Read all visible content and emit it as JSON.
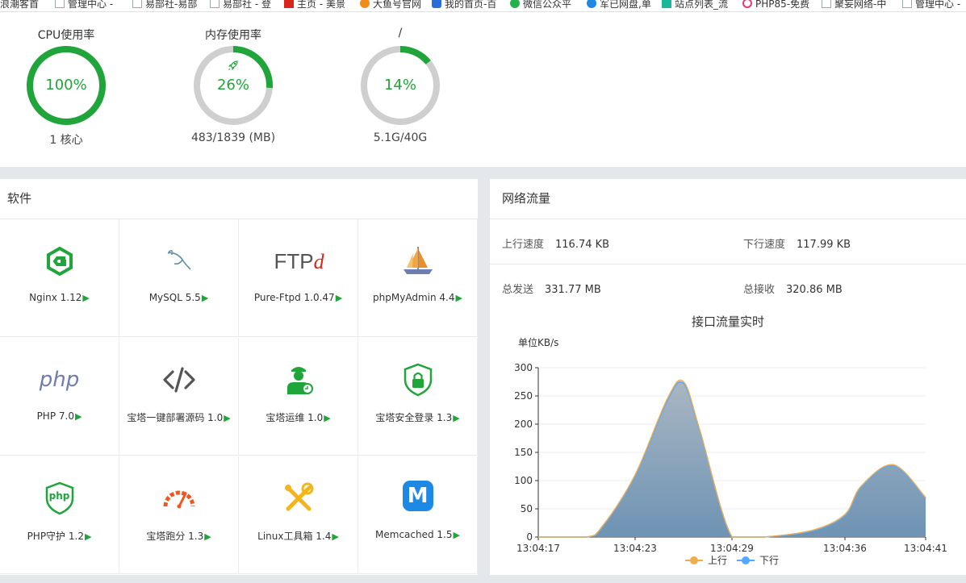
{
  "bookmarks": [
    {
      "label": "浪潮客首",
      "icon": "none"
    },
    {
      "label": "管理中心 -",
      "icon": "page"
    },
    {
      "label": "易部社-易部",
      "icon": "page"
    },
    {
      "label": "易部社 - 登",
      "icon": "page"
    },
    {
      "label": "主页 - 美景",
      "icon": "red"
    },
    {
      "label": "大鱼号官网",
      "icon": "orange"
    },
    {
      "label": "我的首页-百",
      "icon": "blue"
    },
    {
      "label": "微信公众平",
      "icon": "green"
    },
    {
      "label": "军已网盘,单",
      "icon": "lblue"
    },
    {
      "label": "站点列表_流",
      "icon": "teal"
    },
    {
      "label": "PHP85-免费",
      "icon": "ring"
    },
    {
      "label": "聚妄网络-中",
      "icon": "page"
    },
    {
      "label": "管理中心 -",
      "icon": "page"
    }
  ],
  "gauges": [
    {
      "label": "CPU使用率",
      "percent": 100,
      "value_text": "100%",
      "sub": "1 核心",
      "color": "#20a53a"
    },
    {
      "label": "内存使用率",
      "percent": 26,
      "value_text": "26%",
      "sub": "483/1839 (MB)",
      "color": "#20a53a",
      "icon": "rocket-icon"
    },
    {
      "label": "/",
      "percent": 14,
      "value_text": "14%",
      "sub": "5.1G/40G",
      "color": "#20a53a"
    }
  ],
  "software": {
    "title": "软件",
    "items": [
      {
        "name": "Nginx 1.12",
        "icon": "nginx-icon"
      },
      {
        "name": "MySQL 5.5",
        "icon": "mysql-icon"
      },
      {
        "name": "Pure-Ftpd 1.0.47",
        "icon": "ftp-icon",
        "icon_text": "FTP",
        "icon_text2": "d"
      },
      {
        "name": "phpMyAdmin 4.4",
        "icon": "phpmyadmin-icon"
      },
      {
        "name": "PHP 7.0",
        "icon": "php-icon",
        "icon_text": "php"
      },
      {
        "name": "宝塔一键部署源码 1.0",
        "icon": "code-icon"
      },
      {
        "name": "宝塔运维 1.0",
        "icon": "operator-icon"
      },
      {
        "name": "宝塔安全登录 1.3",
        "icon": "shield-lock-icon"
      },
      {
        "name": "PHP守护 1.2",
        "icon": "php-guard-icon",
        "icon_text": "php"
      },
      {
        "name": "宝塔跑分 1.3",
        "icon": "speedometer-icon"
      },
      {
        "name": "Linux工具箱 1.4",
        "icon": "tools-icon"
      },
      {
        "name": "Memcached 1.5",
        "icon": "memcached-icon",
        "icon_text": "M"
      }
    ],
    "arrow": "▶"
  },
  "network": {
    "title": "网络流量",
    "up_speed_label": "上行速度",
    "up_speed": "116.74 KB",
    "down_speed_label": "下行速度",
    "down_speed": "117.99 KB",
    "total_sent_label": "总发送",
    "total_sent": "331.77 MB",
    "total_recv_label": "总接收",
    "total_recv": "320.86 MB"
  },
  "chart_data": {
    "type": "area",
    "title": "接口流量实时",
    "ylabel": "单位KB/s",
    "ylim": [
      0,
      300
    ],
    "yticks": [
      0,
      50,
      100,
      150,
      200,
      250,
      300
    ],
    "x_range": [
      "13:04:17",
      "13:04:41"
    ],
    "x": [
      "13:04:17",
      "13:04:20",
      "13:04:21",
      "13:04:23",
      "13:04:25",
      "13:04:26",
      "13:04:27",
      "13:04:29",
      "13:04:31",
      "13:04:34",
      "13:04:36",
      "13:04:37",
      "13:04:39",
      "13:04:41"
    ],
    "xtick_labels": [
      "13:04:17",
      "13:04:23",
      "13:04:29",
      "13:04:36",
      "13:04:41"
    ],
    "series": [
      {
        "name": "上行",
        "color": "#f0ad4e",
        "values": [
          0,
          0,
          20,
          110,
          245,
          275,
          190,
          0,
          0,
          12,
          40,
          90,
          128,
          70
        ]
      },
      {
        "name": "下行",
        "color": "#52a9ff",
        "values": [
          0,
          0,
          20,
          108,
          242,
          272,
          188,
          0,
          0,
          11,
          38,
          88,
          126,
          68
        ]
      }
    ],
    "grid": true,
    "legend": "bottom"
  }
}
